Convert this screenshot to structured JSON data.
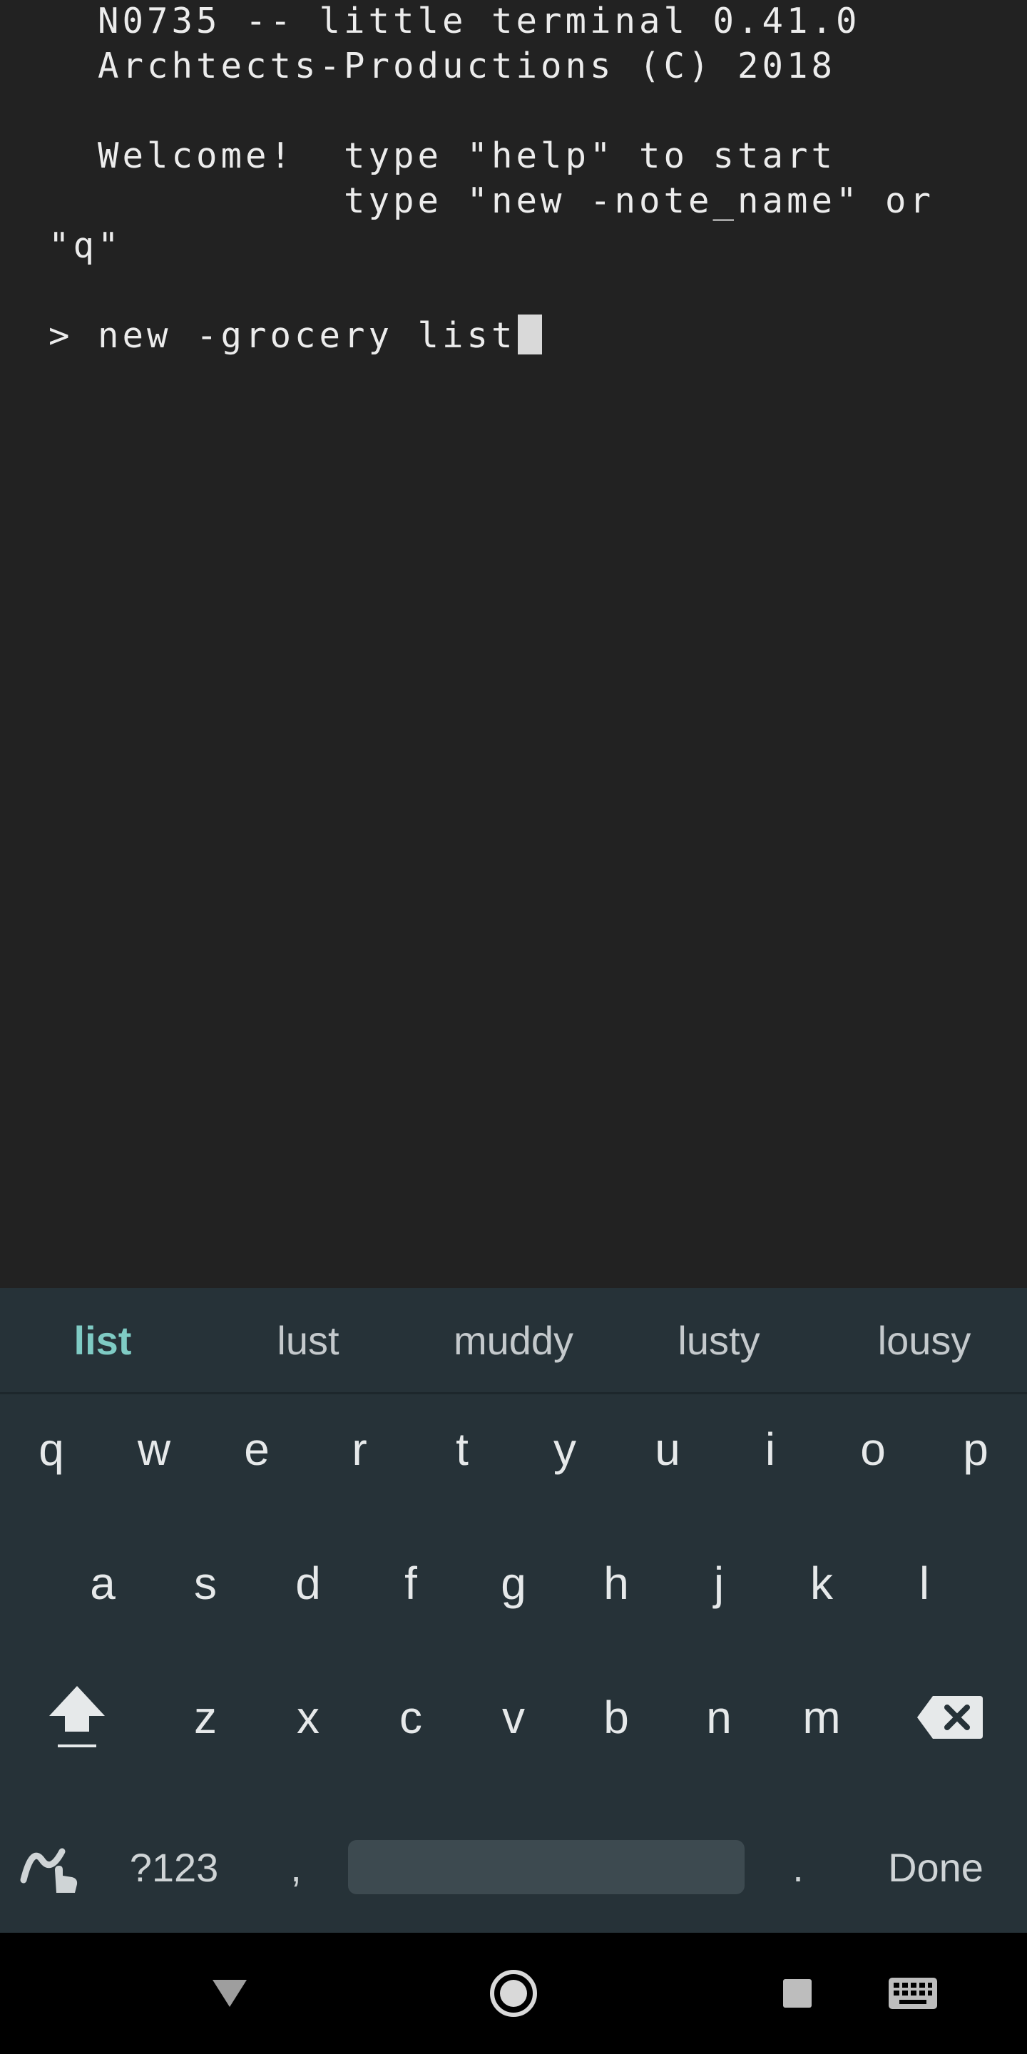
{
  "terminal": {
    "lines": [
      "  N0735 -- little terminal 0.41.0",
      "  Archtects-Productions (C) 2018",
      "",
      "  Welcome!  type \"help\" to start",
      "            type \"new -note_name\" or",
      "\"q\"",
      "",
      "> new -grocery list"
    ]
  },
  "keyboard": {
    "suggestions": [
      "list",
      "lust",
      "muddy",
      "lusty",
      "lousy"
    ],
    "row1": [
      "q",
      "w",
      "e",
      "r",
      "t",
      "y",
      "u",
      "i",
      "o",
      "p"
    ],
    "row2": [
      "a",
      "s",
      "d",
      "f",
      "g",
      "h",
      "j",
      "k",
      "l"
    ],
    "row3": [
      "z",
      "x",
      "c",
      "v",
      "b",
      "n",
      "m"
    ],
    "symbols_label": "?123",
    "comma_label": ",",
    "period_label": ".",
    "done_label": "Done"
  },
  "icons": {
    "shift": "shift-icon",
    "backspace": "backspace-icon",
    "swipe": "swipe-gesture-icon",
    "back": "nav-back-icon",
    "home": "nav-home-icon",
    "recents": "nav-recents-icon",
    "keyboard": "keyboard-switch-icon"
  },
  "colors": {
    "terminal_bg": "#222222",
    "terminal_text": "#ececec",
    "keyboard_bg": "#263238",
    "suggestion_accent": "#7fcbc4"
  }
}
